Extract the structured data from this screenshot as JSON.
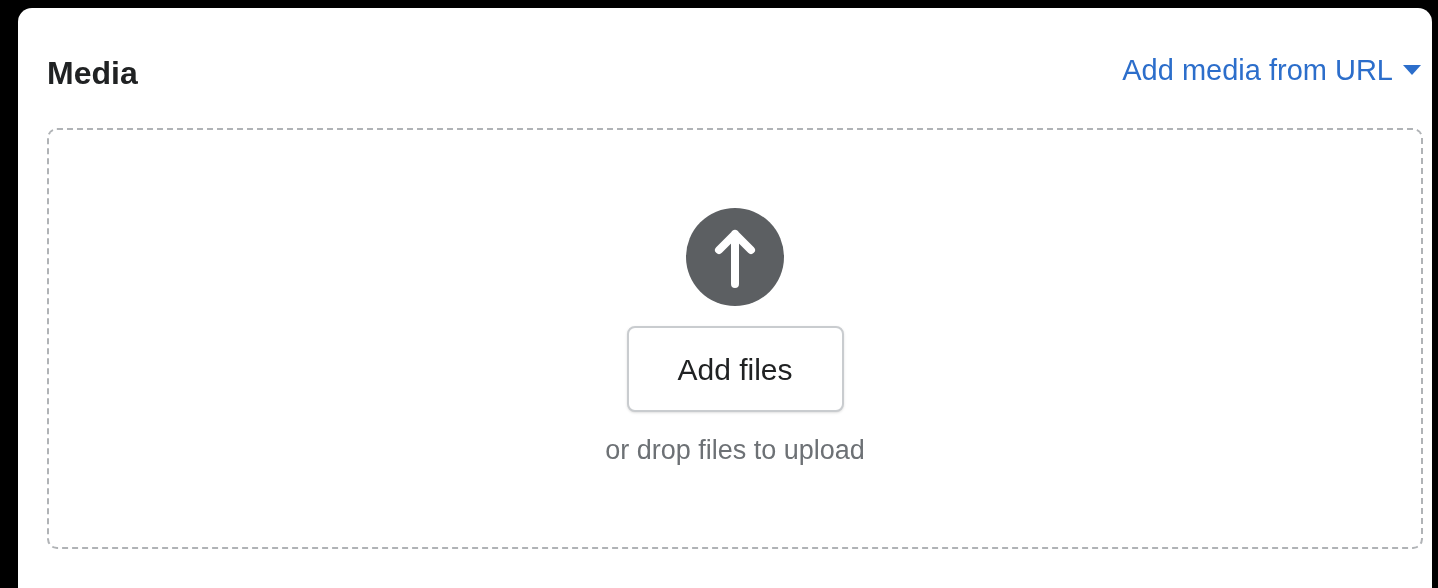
{
  "card": {
    "title": "Media",
    "header_link": "Add media from URL",
    "dropzone": {
      "button": "Add files",
      "hint": "or drop files to upload"
    }
  }
}
